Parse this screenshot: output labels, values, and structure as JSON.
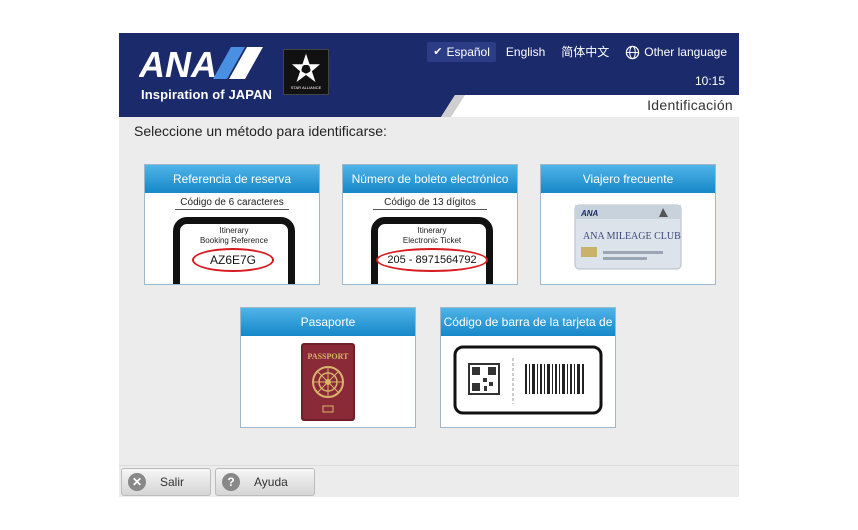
{
  "brand": {
    "logo_text": "ANA",
    "tagline": "Inspiration of JAPAN",
    "alliance_logo_text": "STAR ALLIANCE"
  },
  "languages": [
    {
      "label": "Español",
      "active": true
    },
    {
      "label": "English",
      "active": false
    },
    {
      "label": "简体中文",
      "active": false
    },
    {
      "label": "Other language",
      "active": false,
      "icon": "globe-icon"
    }
  ],
  "clock": "10:15",
  "tab_label": "Identificación",
  "instruction": "Seleccione un método para identificarse:",
  "cards": {
    "reservation": {
      "title": "Referencia de reserva",
      "sub_label": "Código de 6 caracteres",
      "doc_line1": "Itinerary",
      "doc_line2": "Booking Reference",
      "code": "AZ6E7G"
    },
    "eticket": {
      "title": "Número de boleto electrónico",
      "sub_label": "Código de 13 dígitos",
      "doc_line1": "Itinerary",
      "doc_line2": "Electronic Ticket",
      "code": "205 - 8971564792"
    },
    "frequent_flyer": {
      "title": "Viajero frecuente",
      "card_brand": "ANA",
      "card_text": "ANA MILEAGE CLUB"
    },
    "passport": {
      "title": "Pasaporte",
      "cover_text": "PASSPORT"
    },
    "barcode": {
      "title": "Código de barra de la tarjeta de"
    }
  },
  "footer": {
    "exit_label": "Salir",
    "help_label": "Ayuda"
  },
  "colors": {
    "header_bg": "#1b2a6b",
    "card_title_top": "#4fb4e8",
    "card_title_bottom": "#1687c8",
    "highlight_ring": "#d71920"
  }
}
